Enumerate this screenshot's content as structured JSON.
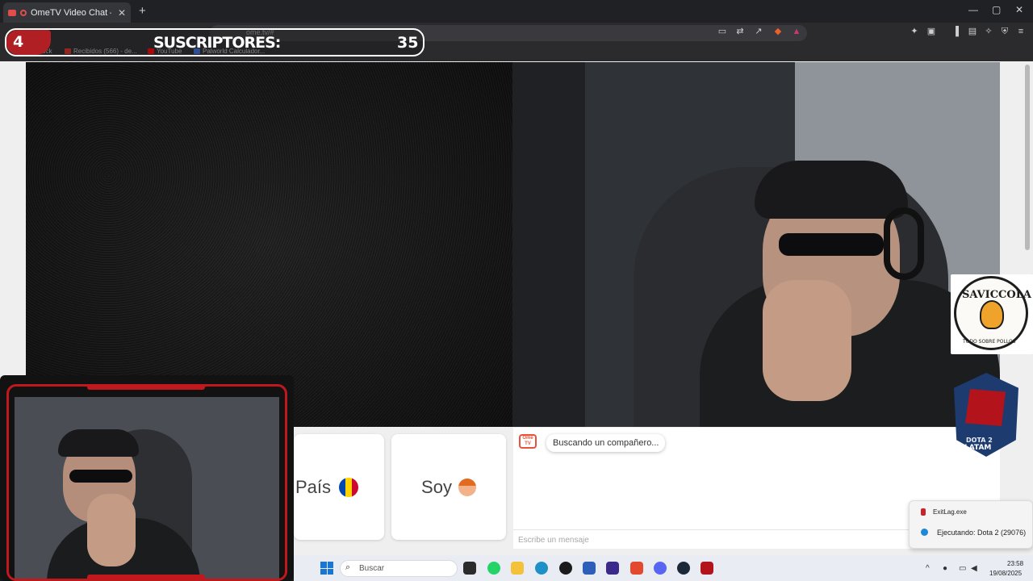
{
  "browser": {
    "tab_title": "OmeTV Video Chat — Omeg",
    "tab_close": "✕",
    "new_tab": "+",
    "url": "ome.tv/#",
    "window_controls": [
      "—",
      "▢",
      "✕"
    ],
    "bookmarks": [
      {
        "label": "ock",
        "icon_color": "#555555"
      },
      {
        "label": "Recibidos (566) - de...",
        "icon_color": "#d93025"
      },
      {
        "label": "YouTube",
        "icon_color": "#ff0000"
      },
      {
        "label": "Palworld Calculador...",
        "icon_color": "#3d6fd9"
      }
    ]
  },
  "overlay": {
    "badge_number": "4",
    "subscribers_label": "SUSCRIPTORES:",
    "subscribers_count": "35"
  },
  "controls": {
    "country_label": "País",
    "gender_label": "Soy"
  },
  "chat": {
    "logo_text": "Ome TV",
    "status_message": "Buscando un compañero...",
    "message_placeholder": "Escribe un mensaje"
  },
  "logos": {
    "saviccola_title": "SAVICCOLA",
    "saviccola_subtitle": "TODO SOBRE POLLOS",
    "dota_label": "DOTA 2",
    "dota_region": "LATAM"
  },
  "notification": {
    "app_name": "ExitLag.exe",
    "status": "Ejecutando: Dota 2 (29076)"
  },
  "taskbar": {
    "search_placeholder": "Buscar",
    "time": "23:58",
    "date": "19/08/2025",
    "apps": [
      {
        "name": "task-view",
        "color": "#2b2b2b"
      },
      {
        "name": "file-explorer",
        "color": "#f3c13a"
      },
      {
        "name": "edge",
        "color": "#1e90c8"
      },
      {
        "name": "github",
        "color": "#1b1b1b"
      },
      {
        "name": "word",
        "color": "#2b5fb8"
      },
      {
        "name": "proton-vpn",
        "color": "#3b2a8a"
      },
      {
        "name": "brave",
        "color": "#e2492f"
      },
      {
        "name": "discord",
        "color": "#5865f2"
      },
      {
        "name": "steam",
        "color": "#1b2838"
      },
      {
        "name": "dota2",
        "color": "#b3141b"
      }
    ]
  }
}
